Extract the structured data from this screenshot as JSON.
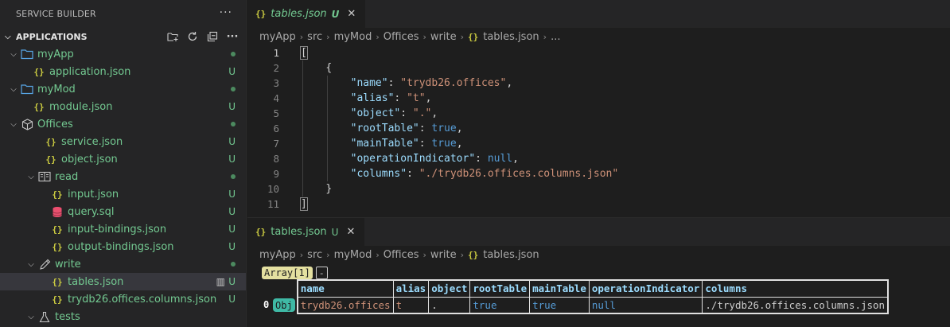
{
  "sidebar": {
    "title": "SERVICE BUILDER",
    "section_title": "APPLICATIONS",
    "tree": [
      {
        "label": "myApp",
        "depth": 1,
        "expanded": true,
        "icon": "folder-icon",
        "status": "dot"
      },
      {
        "label": "application.json",
        "depth": 2,
        "icon": "json-icon",
        "status": "U"
      },
      {
        "label": "myMod",
        "depth": 1,
        "expanded": true,
        "icon": "folder-icon",
        "status": "dot"
      },
      {
        "label": "module.json",
        "depth": 2,
        "icon": "json-icon",
        "status": "U"
      },
      {
        "label": "Offices",
        "depth": 1,
        "expanded": true,
        "icon": "cube-icon",
        "status": "dot"
      },
      {
        "label": "service.json",
        "depth": 2,
        "icon": "json-icon",
        "status": "U"
      },
      {
        "label": "object.json",
        "depth": 2,
        "icon": "json-icon",
        "status": "U"
      },
      {
        "label": "read",
        "depth": 2,
        "expanded": true,
        "icon": "book-icon",
        "status": "dot"
      },
      {
        "label": "input.json",
        "depth": 3,
        "icon": "json-icon",
        "status": "U"
      },
      {
        "label": "query.sql",
        "depth": 3,
        "icon": "database-icon",
        "status": "U"
      },
      {
        "label": "input-bindings.json",
        "depth": 3,
        "icon": "json-icon",
        "status": "U"
      },
      {
        "label": "output-bindings.json",
        "depth": 3,
        "icon": "json-icon",
        "status": "U"
      },
      {
        "label": "write",
        "depth": 2,
        "expanded": true,
        "icon": "pencil-icon",
        "status": "dot"
      },
      {
        "label": "tables.json",
        "depth": 3,
        "icon": "json-icon",
        "status": "U",
        "selected": true
      },
      {
        "label": "trydb26.offices.columns.json",
        "depth": 3,
        "icon": "json-icon",
        "status": "U"
      },
      {
        "label": "tests",
        "depth": 2,
        "expanded": true,
        "icon": "flask-icon",
        "status": ""
      }
    ]
  },
  "editor": {
    "tab": {
      "label": "tables.json",
      "status": "U"
    },
    "breadcrumb": [
      "myApp",
      "src",
      "myMod",
      "Offices",
      "write",
      "tables.json",
      "..."
    ],
    "code": {
      "line_numbers": [
        "1",
        "2",
        "3",
        "4",
        "5",
        "6",
        "7",
        "8",
        "9",
        "10",
        "11"
      ],
      "open_bracket": "[",
      "close_bracket": "]",
      "open_brace": "{",
      "close_brace": "}",
      "entries": [
        {
          "key": "\"name\"",
          "value": "\"trydb26.offices\"",
          "type": "string",
          "comma": ","
        },
        {
          "key": "\"alias\"",
          "value": "\"t\"",
          "type": "string",
          "comma": ","
        },
        {
          "key": "\"object\"",
          "value": "\".\"",
          "type": "string",
          "comma": ","
        },
        {
          "key": "\"rootTable\"",
          "value": "true",
          "type": "bool",
          "comma": ","
        },
        {
          "key": "\"mainTable\"",
          "value": "true",
          "type": "bool",
          "comma": ","
        },
        {
          "key": "\"operationIndicator\"",
          "value": "null",
          "type": "null",
          "comma": ","
        },
        {
          "key": "\"columns\"",
          "value": "\"./trydb26.offices.columns.json\"",
          "type": "string",
          "comma": ""
        }
      ]
    }
  },
  "preview": {
    "tab": {
      "label": "tables.json",
      "status": "U"
    },
    "breadcrumb": [
      "myApp",
      "src",
      "myMod",
      "Offices",
      "write",
      "tables.json"
    ],
    "array_badge": "Array[1]",
    "collapse_label": "-",
    "row_index": "0",
    "obj_badge": "Obj",
    "columns": [
      "name",
      "alias",
      "object",
      "rootTable",
      "mainTable",
      "operationIndicator",
      "columns"
    ],
    "rows": [
      [
        {
          "v": "trydb26.offices",
          "t": "str"
        },
        {
          "v": "t",
          "t": "str"
        },
        {
          "v": ".",
          "t": "sym"
        },
        {
          "v": "true",
          "t": "bool"
        },
        {
          "v": "true",
          "t": "bool"
        },
        {
          "v": "null",
          "t": "null"
        },
        {
          "v": "./trydb26.offices.columns.json",
          "t": "sym"
        }
      ]
    ]
  },
  "colors": {
    "untracked": "#73c991",
    "json_icon": "#cbcb41",
    "selection": "#37373d"
  }
}
